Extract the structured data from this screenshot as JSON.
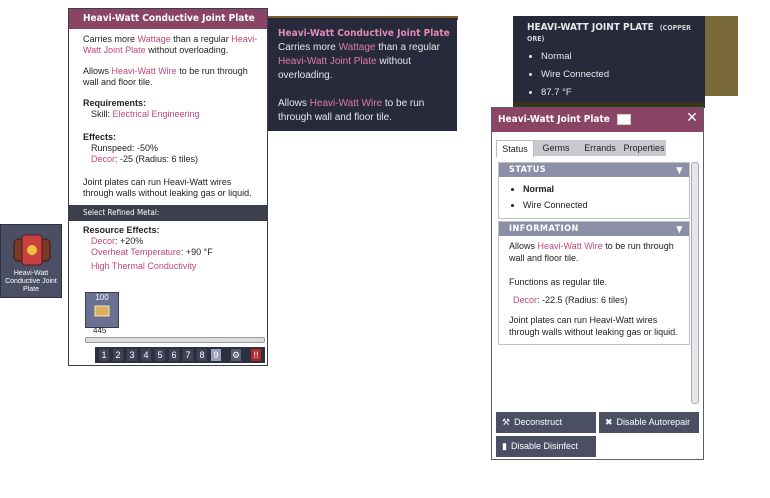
{
  "build_tile": {
    "label": "Heavi-Watt Conductive Joint Plate",
    "icon": "joint-plate-icon"
  },
  "build_panel": {
    "title": "Heavi-Watt Conductive Joint Plate",
    "desc_pre": "Carries more ",
    "desc_wattage": "Wattage",
    "desc_mid": " than a regular ",
    "desc_link": "Heavi-Watt Joint Plate",
    "desc_post": " without overloading.",
    "allows_pre": "Allows ",
    "allows_link": "Heavi-Watt Wire",
    "allows_post": " to be run through wall and floor tile.",
    "requirements_head": "Requirements:",
    "skill_label": "Skill: ",
    "skill_value": "Electrical Engineering",
    "effects_head": "Effects:",
    "runspeed": "Runspeed: -50%",
    "decor_label": "Decor",
    "decor_value": ": -25 (Radius: 6 tiles)",
    "note": "Joint plates can run Heavi-Watt wires through walls without leaking gas or liquid.",
    "select_label": "Select Refined Metal:",
    "resource_head": "Resource Effects:",
    "res_decor_label": "Decor",
    "res_decor_value": ": +20%",
    "res_temp_label": "Overheat Temperature",
    "res_temp_value": ": +90 °F",
    "res_conductivity": "High Thermal Conductivity",
    "material_qty": "100",
    "material_count": "445",
    "digits": [
      "1",
      "2",
      "3",
      "4",
      "5",
      "6",
      "7",
      "8",
      "9"
    ],
    "selected_digit": "9",
    "alert_label": "!!"
  },
  "tooltip": {
    "title": "Heavi-Watt Conductive Joint Plate",
    "l1_pre": "Carries more ",
    "l1_wattage": "Wattage",
    "l1_mid": " than a regular ",
    "l1_link": "Heavi-Watt Joint Plate",
    "l1_post": " without overloading.",
    "l2_pre": "Allows ",
    "l2_link": "Heavi-Watt Wire",
    "l2_post": " to be run through wall and floor tile."
  },
  "hover_card": {
    "title": "HEAVI-WATT JOINT PLATE",
    "subtitle": "(COPPER ORE)",
    "items": [
      "Normal",
      "Wire Connected",
      "87.7 °F"
    ]
  },
  "info_panel": {
    "title": "Heavi-Watt Joint Plate",
    "close": "✕",
    "tabs": [
      "Status",
      "Germs",
      "Errands",
      "Properties"
    ],
    "status_head": "STATUS",
    "status_items": [
      "Normal",
      "Wire Connected"
    ],
    "info_head": "INFORMATION",
    "info_pre": "Allows ",
    "info_link": "Heavi-Watt Wire",
    "info_post": " to be run through wall and floor tile.",
    "info_func": "Functions as regular tile.",
    "info_decor_label": "Decor",
    "info_decor_value": ": -22.5 (Radius: 6 tiles)",
    "info_note": "Joint plates can run Heavi-Watt wires through walls without leaking gas or liquid.",
    "buttons": {
      "deconstruct": "Deconstruct",
      "disable_autorepair": "Disable Autorepair",
      "disable_disinfect": "Disable Disinfect"
    }
  },
  "colors": {
    "accent": "#8a4566",
    "link": "#c0477c",
    "panel_dark": "#262a3a"
  }
}
